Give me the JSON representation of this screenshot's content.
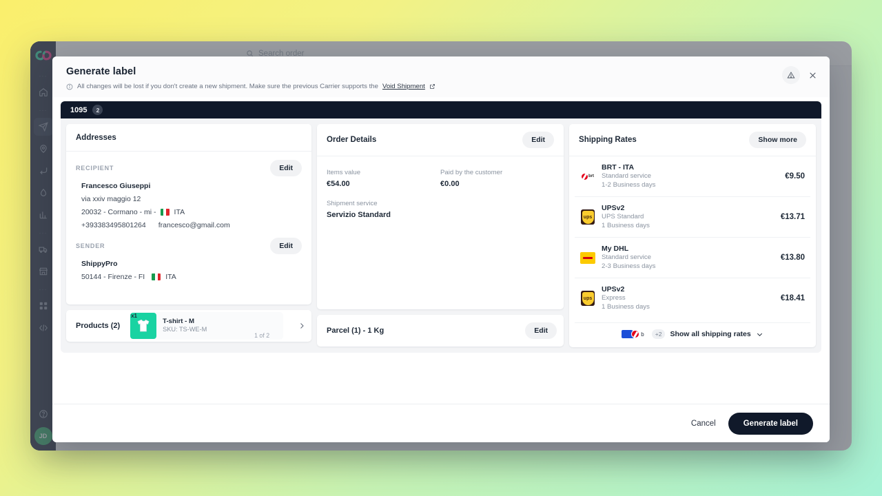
{
  "background": {
    "gradient_from": "#faee6b",
    "gradient_to": "#a5f2d8"
  },
  "app": {
    "search_placeholder": "Search order",
    "sidebar": {
      "logo_name": "shippypro-logo",
      "items": [
        {
          "icon": "home-icon",
          "name": "home"
        },
        {
          "icon": "paper-plane-icon",
          "name": "ship"
        },
        {
          "icon": "map-pin-icon",
          "name": "track"
        },
        {
          "icon": "return-arrow-icon",
          "name": "returns"
        },
        {
          "icon": "drop-icon",
          "name": "easy-return"
        },
        {
          "icon": "bar-chart-icon",
          "name": "analytics"
        },
        {
          "icon": "truck-icon",
          "name": "carriers"
        },
        {
          "icon": "store-icon",
          "name": "marketplaces"
        },
        {
          "icon": "grid-icon",
          "name": "apps"
        },
        {
          "icon": "code-icon",
          "name": "developers"
        },
        {
          "icon": "help-circle-icon",
          "name": "help"
        }
      ],
      "avatar_initials": "JD",
      "avatar_color": "#27a663"
    }
  },
  "modal": {
    "title": "Generate label",
    "notice": "All changes will be lost if you don't create a new shipment. Make sure the previous Carrier supports the",
    "notice_link": "Void Shipment",
    "warning_icon": "warning-triangle-icon",
    "close_icon": "close-icon",
    "order": {
      "number": "1095",
      "count": "2"
    },
    "addresses": {
      "title": "Addresses",
      "recipient": {
        "label": "RECIPIENT",
        "edit_label": "Edit",
        "name": "Francesco Giuseppi",
        "street": "via xxiv maggio 12",
        "city_line": "20032 - Cormano - mi -",
        "country": "ITA",
        "phone": "+393383495801264",
        "email": "francesco@gmail.com"
      },
      "sender": {
        "label": "SENDER",
        "edit_label": "Edit",
        "name": "ShippyPro",
        "city_line": "50144 - Firenze - FI",
        "country": "ITA"
      }
    },
    "order_details": {
      "title": "Order Details",
      "edit_label": "Edit",
      "items_value_label": "Items value",
      "items_value": "€54.00",
      "paid_label": "Paid by the customer",
      "paid_value": "€0.00",
      "shipment_service_label": "Shipment service",
      "shipment_service_value": "Servizio Standard"
    },
    "shipping_rates": {
      "title": "Shipping Rates",
      "show_more_label": "Show more",
      "rates": [
        {
          "logo": "brt-logo",
          "carrier": "BRT - ITA",
          "service": "Standard service",
          "days": "1-2 Business days",
          "price": "€9.50"
        },
        {
          "logo": "ups-logo",
          "carrier": "UPSv2",
          "service": "UPS Standard",
          "days": "1 Business days",
          "price": "€13.71"
        },
        {
          "logo": "dhl-logo",
          "carrier": "My DHL",
          "service": "Standard service",
          "days": "2-3 Business days",
          "price": "€13.80"
        },
        {
          "logo": "ups-logo",
          "carrier": "UPSv2",
          "service": "Express",
          "days": "1 Business days",
          "price": "€18.41"
        }
      ],
      "footer": {
        "more_carriers_badge": "+2",
        "mini_label": "b",
        "show_all_label": "Show all shipping rates",
        "chevron_icon": "chevron-down-icon"
      }
    },
    "products": {
      "title": "Products (2)",
      "item": {
        "qty": "x1",
        "name": "T-shirt - M",
        "sku": "SKU: TS-WE-M",
        "pager": "1 of 2",
        "chevron_icon": "chevron-right-icon",
        "thumb_color": "#19d3a2"
      }
    },
    "parcel": {
      "title": "Parcel (1) - 1 Kg",
      "edit_label": "Edit"
    },
    "footer": {
      "cancel_label": "Cancel",
      "primary_label": "Generate label"
    }
  }
}
